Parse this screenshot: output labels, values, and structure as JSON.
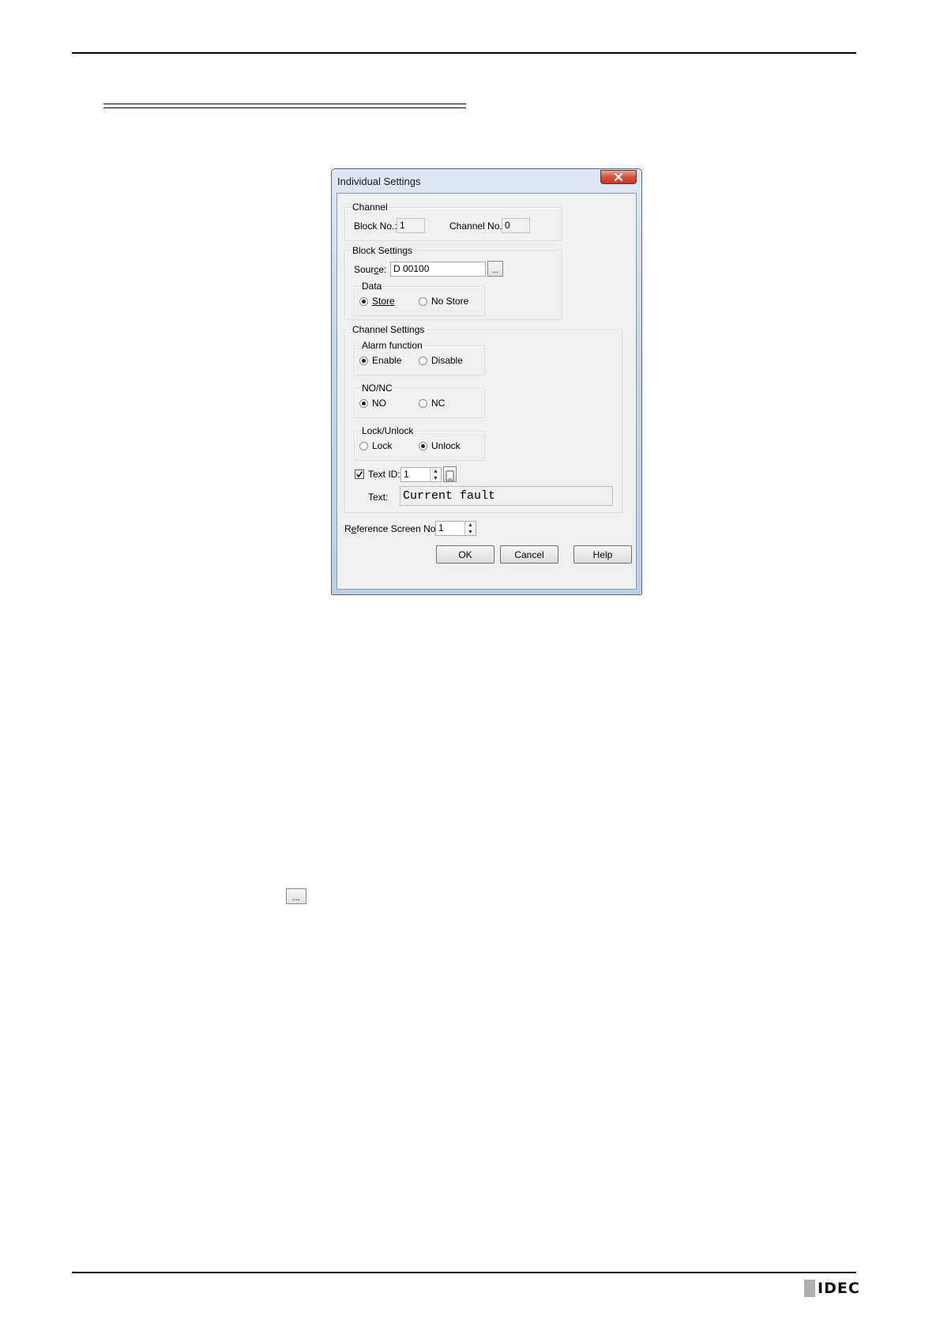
{
  "dialog": {
    "title": "Individual Settings",
    "close_icon": "close-x-icon",
    "channel": {
      "group_label": "Channel",
      "block_no_label": "Block No.:",
      "block_no_value": "1",
      "channel_no_label": "Channel No.:",
      "channel_no_value": "0"
    },
    "block_settings": {
      "group_label": "Block Settings",
      "source_label": "Source:",
      "source_value": "D 00100",
      "browse_label": "...",
      "data": {
        "group_label": "Data",
        "store_label": "Store",
        "no_store_label": "No Store",
        "selected": "Store"
      }
    },
    "channel_settings": {
      "group_label": "Channel Settings",
      "alarm_function": {
        "group_label": "Alarm function",
        "enable_label": "Enable",
        "disable_label": "Disable",
        "selected": "Enable"
      },
      "no_nc": {
        "group_label": "NO/NC",
        "no_label": "NO",
        "nc_label": "NC",
        "selected": "NO"
      },
      "lock_unlock": {
        "group_label": "Lock/Unlock",
        "lock_label": "Lock",
        "unlock_label": "Unlock",
        "selected": "Unlock"
      },
      "text_id_label": "Text ID:",
      "text_id_checked": true,
      "text_id_value": "1",
      "text_label": "Text:",
      "text_value": "Current fault"
    },
    "reference_screen_label": "Reference Screen No.:",
    "reference_screen_value": "1",
    "buttons": {
      "ok": "OK",
      "cancel": "Cancel",
      "help": "Help"
    }
  },
  "page": {
    "inline_button_label": "...",
    "logo_text": "IDEC"
  }
}
